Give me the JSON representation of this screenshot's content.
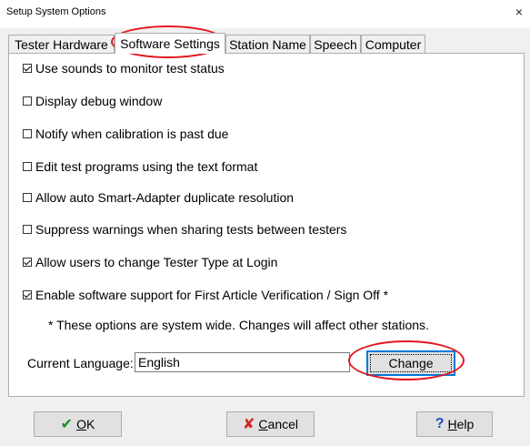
{
  "window": {
    "title": "Setup System Options",
    "close_glyph": "×"
  },
  "tabs": [
    {
      "label": "Tester Hardware"
    },
    {
      "label": "Software Settings"
    },
    {
      "label": "Station Name"
    },
    {
      "label": "Speech"
    },
    {
      "label": "Computer"
    }
  ],
  "active_tab": "Software Settings",
  "options": [
    {
      "label": "Use sounds to monitor test status",
      "checked": true
    },
    {
      "label": "Display debug window",
      "checked": false
    },
    {
      "label": "Notify when calibration is past due",
      "checked": false
    },
    {
      "label": "Edit test programs using the text format",
      "checked": false
    },
    {
      "label": "Allow auto Smart-Adapter duplicate resolution",
      "checked": false
    },
    {
      "label": "Suppress warnings when sharing tests between testers",
      "checked": false
    },
    {
      "label": "Allow users to change Tester Type at Login",
      "checked": true
    },
    {
      "label": "Enable software support for First Article Verification / Sign Off *",
      "checked": true
    }
  ],
  "note": "* These options are system wide. Changes will affect other stations.",
  "language": {
    "label": "Current Language:",
    "value": "English",
    "change_label": "Change"
  },
  "buttons": {
    "ok": {
      "icon": "check-icon",
      "mnemonic": "O",
      "rest": "K"
    },
    "cancel": {
      "icon": "x-icon",
      "mnemonic": "C",
      "rest": "ancel"
    },
    "help": {
      "icon": "question-icon",
      "mnemonic": "H",
      "rest": "elp"
    }
  },
  "annotation_color": "#e2161d"
}
